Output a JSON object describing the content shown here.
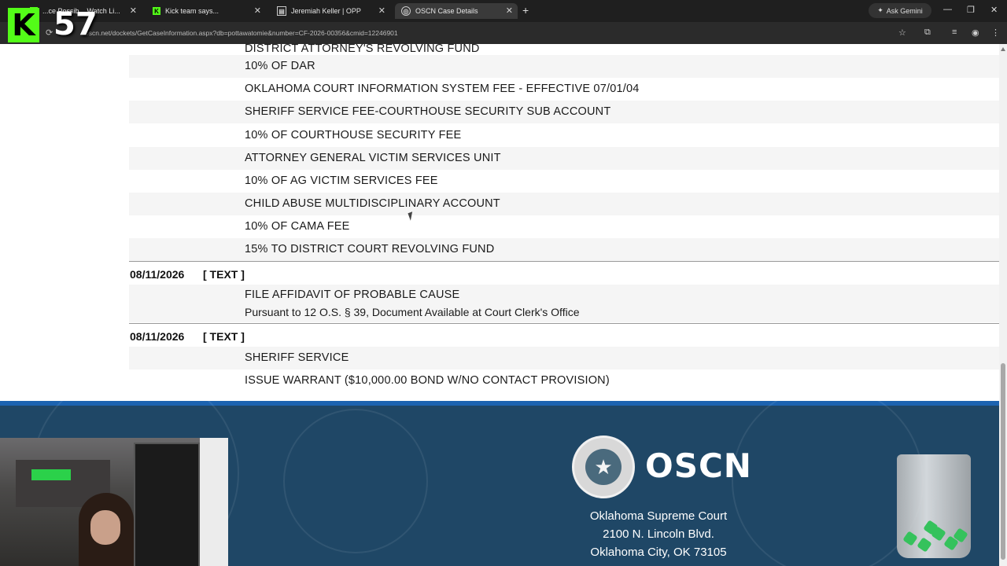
{
  "browser": {
    "tabs": [
      {
        "title": "...ce Possib... Watch Li...",
        "active": false
      },
      {
        "title": "Kick team says...",
        "active": false
      },
      {
        "title": "Jeremiah Keller | OPP",
        "active": false
      },
      {
        "title": "OSCN Case Details",
        "active": true
      }
    ],
    "ask_gemini": "Ask Gemini",
    "url": "oscn.net/dockets/GetCaseInformation.aspx?db=pottawatomie&number=CF-2026-00356&cmid=12246901"
  },
  "overlay": {
    "kick_logo": "K",
    "viewer_count": "57"
  },
  "docket": {
    "top_partial": "DISTRICT ATTORNEY'S REVOLVING FUND",
    "fee_lines": [
      "10% OF DAR",
      "OKLAHOMA COURT INFORMATION SYSTEM FEE - EFFECTIVE 07/01/04",
      "SHERIFF SERVICE FEE-COURTHOUSE SECURITY SUB ACCOUNT",
      "10% OF COURTHOUSE SECURITY FEE",
      "ATTORNEY GENERAL VICTIM SERVICES UNIT",
      "10% OF AG VICTIM SERVICES FEE",
      "CHILD ABUSE MULTIDISCIPLINARY ACCOUNT",
      "10% OF CAMA FEE",
      "15% TO DISTRICT COURT REVOLVING FUND"
    ],
    "entries": [
      {
        "date": "08/11/2026",
        "code": "[ TEXT ]",
        "lines": [
          "FILE AFFIDAVIT OF PROBABLE CAUSE"
        ],
        "note": "Pursuant to 12 O.S. § 39, Document Available at Court Clerk's Office"
      },
      {
        "date": "08/11/2026",
        "code": "[ TEXT ]",
        "lines": [
          "SHERIFF SERVICE",
          "ISSUE WARRANT ($10,000.00 BOND W/NO CONTACT PROVISION)"
        ]
      }
    ]
  },
  "footer": {
    "brand": "OSCN",
    "address": [
      "Oklahoma Supreme Court",
      "2100 N. Lincoln Blvd.",
      "Oklahoma City, OK 73105"
    ]
  },
  "colors": {
    "footer_bg": "#1f4766",
    "footer_accent": "#1c63b0",
    "row_shade": "#f5f5f5",
    "kick_green": "#53fc18"
  }
}
